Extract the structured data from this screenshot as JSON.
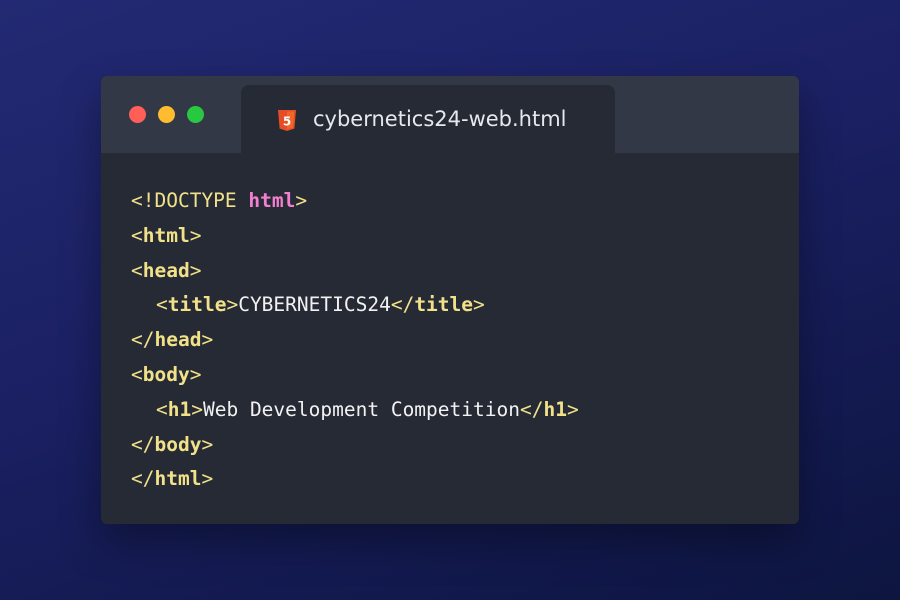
{
  "window": {
    "tab": {
      "filename": "cybernetics24-web.html",
      "icon": "html5-icon",
      "icon_label": "5"
    }
  },
  "code": {
    "doctype": {
      "open": "<!DOCTYPE ",
      "keyword": "html",
      "close": ">"
    },
    "html_open": {
      "open": "<",
      "tag": "html",
      "close": ">"
    },
    "head_open": {
      "open": "<",
      "tag": "head",
      "close": ">"
    },
    "title_line": {
      "open1": "<",
      "tag1": "title",
      "close1": ">",
      "text": "CYBERNETICS24",
      "open2": "</",
      "tag2": "title",
      "close2": ">"
    },
    "head_close": {
      "open": "</",
      "tag": "head",
      "close": ">"
    },
    "body_open": {
      "open": "<",
      "tag": "body",
      "close": ">"
    },
    "h1_line": {
      "open1": "<",
      "tag1": "h1",
      "close1": ">",
      "text": "Web Development Competition",
      "open2": "</",
      "tag2": "h1",
      "close2": ">"
    },
    "body_close": {
      "open": "</",
      "tag": "body",
      "close": ">"
    },
    "html_close": {
      "open": "</",
      "tag": "html",
      "close": ">"
    }
  },
  "colors": {
    "tag": "#f1e28a",
    "keyword": "#f27fd0",
    "text": "#f2f2f2",
    "editor_bg": "#262a35",
    "titlebar_bg": "#333846",
    "html5_orange": "#e44d26"
  }
}
